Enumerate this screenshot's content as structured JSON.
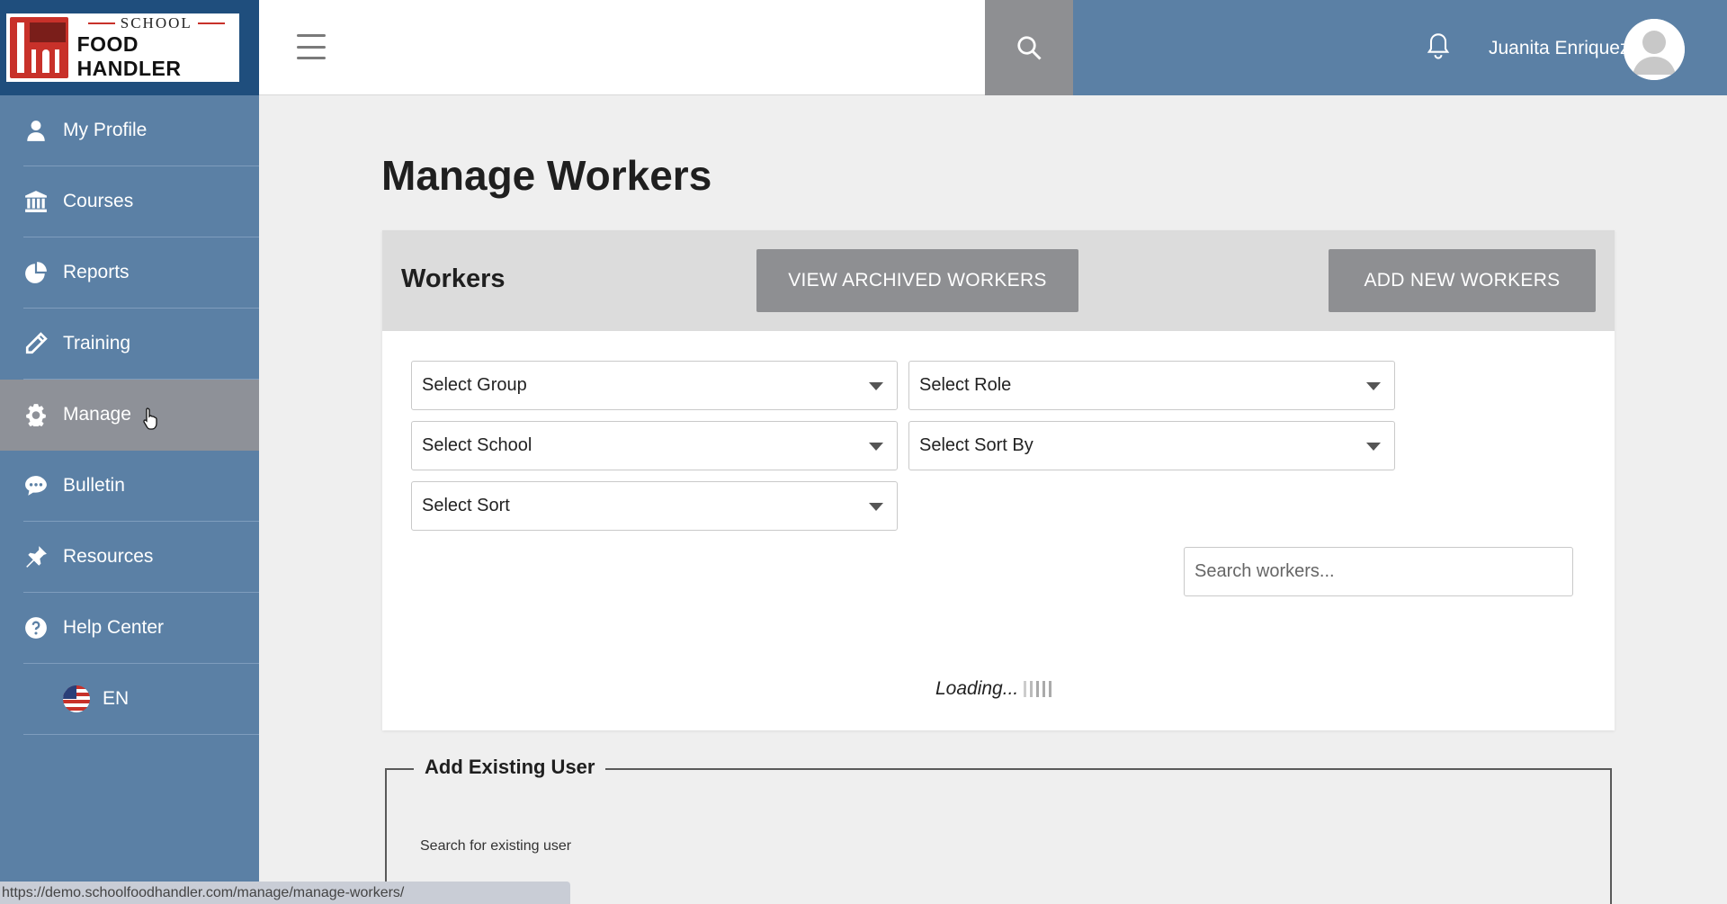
{
  "brand": {
    "logo_top": "SCHOOL",
    "logo_bottom": "FOOD HANDLER"
  },
  "sidebar": {
    "items": [
      {
        "label": "My Profile",
        "icon": "user-icon"
      },
      {
        "label": "Courses",
        "icon": "bank-icon"
      },
      {
        "label": "Reports",
        "icon": "pie-chart-icon"
      },
      {
        "label": "Training",
        "icon": "pencil-icon"
      },
      {
        "label": "Manage",
        "icon": "gear-icon",
        "active": true
      },
      {
        "label": "Bulletin",
        "icon": "chat-icon"
      },
      {
        "label": "Resources",
        "icon": "pin-icon"
      },
      {
        "label": "Help Center",
        "icon": "help-icon"
      }
    ],
    "language": "EN"
  },
  "header": {
    "username": "Juanita Enriquez"
  },
  "main": {
    "title": "Manage Workers",
    "panel": {
      "title": "Workers",
      "view_archived_label": "VIEW ARCHIVED WORKERS",
      "add_new_label": "ADD NEW WORKERS"
    },
    "filters": {
      "group": "Select Group",
      "role": "Select Role",
      "school": "Select School",
      "sort_by": "Select Sort By",
      "sort": "Select Sort"
    },
    "search": {
      "placeholder": "Search workers..."
    },
    "loading_text": "Loading...",
    "add_existing": {
      "legend": "Add Existing User",
      "label": "Search for existing user"
    }
  },
  "status_url": "https://demo.schoolfoodhandler.com/manage/manage-workers/",
  "colors": {
    "sidebar": "#5b80a5",
    "logo_bg": "#1f4e7d",
    "button_gray": "#8e8f92",
    "brand_red": "#c8312a"
  }
}
